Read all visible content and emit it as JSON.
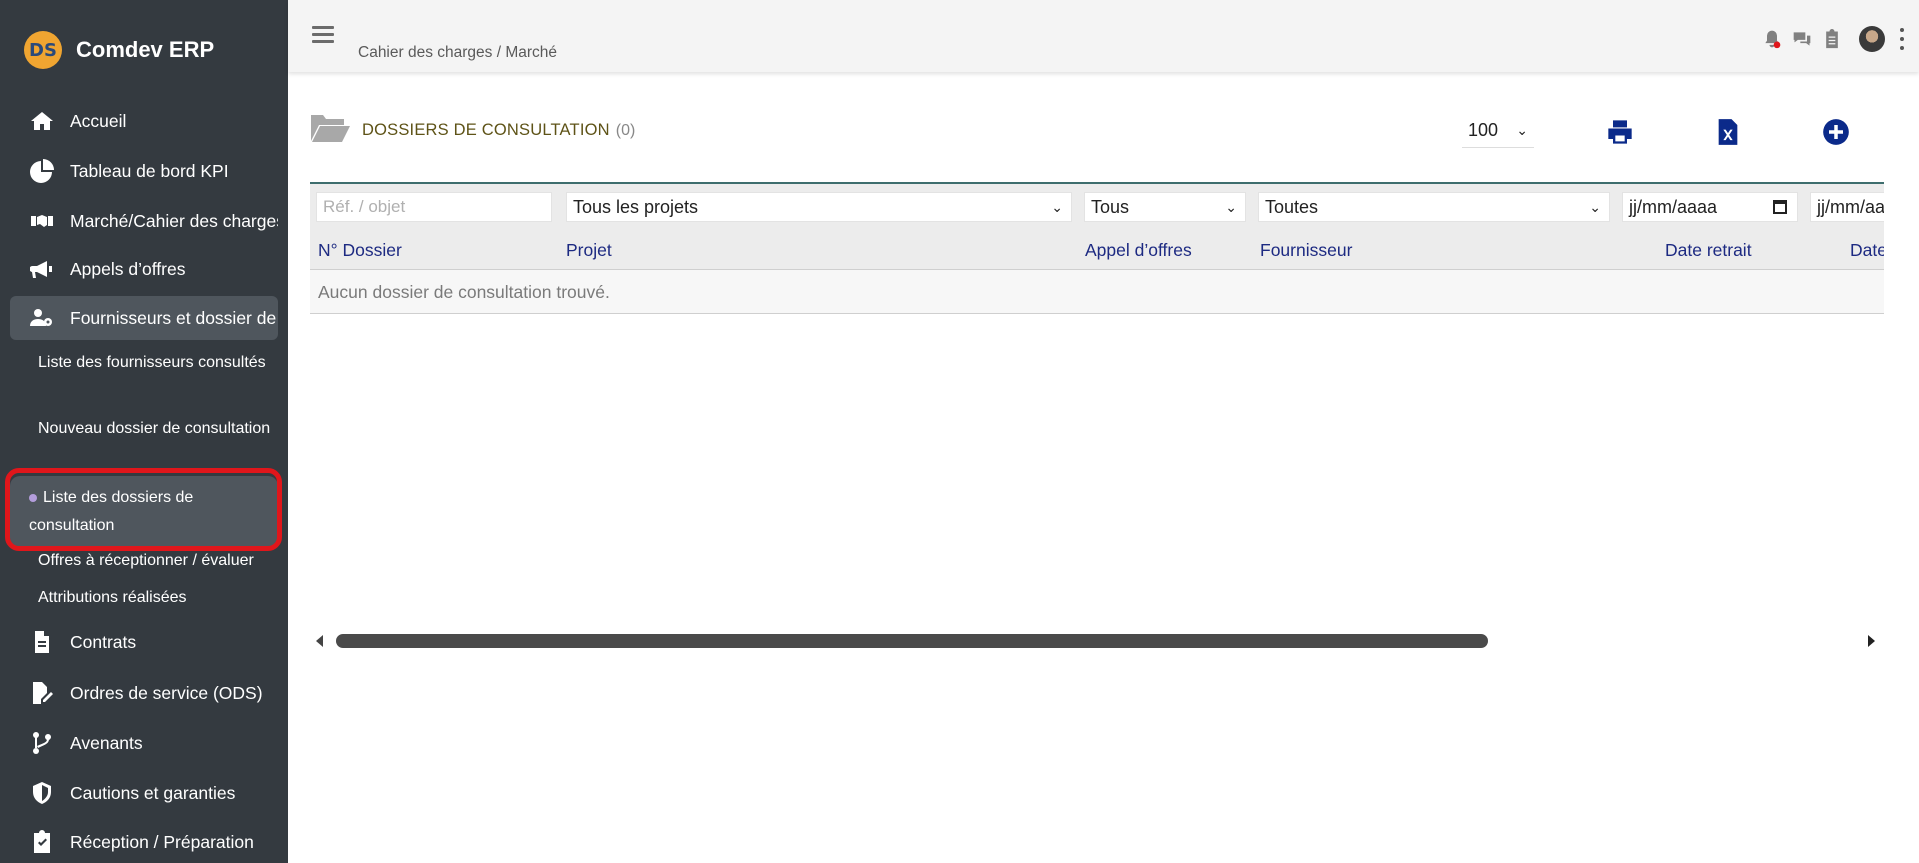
{
  "brand": {
    "logo_text": "DS",
    "name": "Comdev ERP"
  },
  "sidebar": {
    "items": [
      {
        "label": "Accueil",
        "icon": "home-icon"
      },
      {
        "label": "Tableau de bord KPI",
        "icon": "chart-pie-icon"
      },
      {
        "label": "Marché/Cahier des charges",
        "icon": "handshake-icon"
      },
      {
        "label": "Appels d’offres",
        "icon": "bullhorn-icon"
      },
      {
        "label": "Fournisseurs et dossier de consultation",
        "icon": "users-cog-icon"
      },
      {
        "label": "Contrats",
        "icon": "file-pdf-icon"
      },
      {
        "label": "Ordres de service (ODS)",
        "icon": "file-signature-icon"
      },
      {
        "label": "Avenants",
        "icon": "code-branch-icon"
      },
      {
        "label": "Cautions et garanties",
        "icon": "shield-icon"
      },
      {
        "label": "Réception / Préparation",
        "icon": "clipboard-check-icon"
      }
    ],
    "sub_items": [
      "Liste des fournisseurs consultés",
      "Nouveau dossier de consultation",
      "Liste des dossiers de consultation",
      "Offres à réceptionner / évaluer",
      "Attributions réalisées"
    ]
  },
  "header": {
    "breadcrumb": "Cahier des charges / Marché"
  },
  "main": {
    "title": "DOSSIERS DE CONSULTATION",
    "count": "(0)",
    "per_page": "100",
    "filters": {
      "ref_placeholder": "Réf. / objet",
      "projet": "Tous les projets",
      "appel": "Tous",
      "fournisseur": "Toutes",
      "date1": "jj/mm/aaaa",
      "date2": "jj/mm/aaaa"
    },
    "columns": [
      "N° Dossier",
      "Projet",
      "Appel d’offres",
      "Fournisseur",
      "Date retrait",
      "Date"
    ],
    "empty_message": "Aucun dossier de consultation trouvé."
  },
  "colors": {
    "sidebar_bg": "#343a40",
    "accent_blue": "#0b2a8a",
    "highlight_red": "#e0161b"
  }
}
